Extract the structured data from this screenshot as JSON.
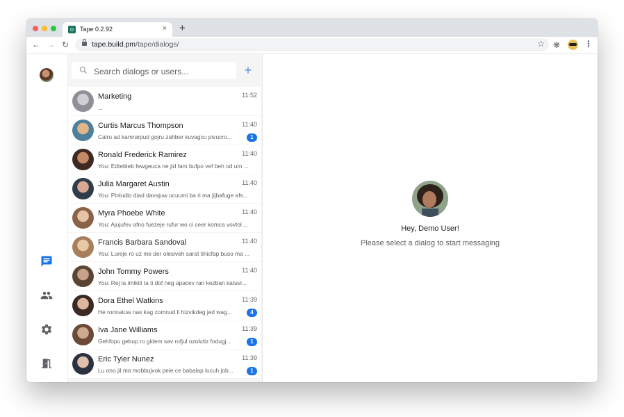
{
  "browser": {
    "tab_title": "Tape 0.2.92",
    "tab_close": "×",
    "new_tab": "+",
    "url_host": "tape.build.pm",
    "url_path": "/tape/dialogs/",
    "icons": [
      "back-icon",
      "forward-icon",
      "reload-icon",
      "lock-icon",
      "star-icon",
      "extensions-icon",
      "profile-icon",
      "menu-icon"
    ]
  },
  "sidebar": {
    "search_placeholder": "Search dialogs or users...",
    "add_label": "+",
    "dialogs": [
      {
        "name": "Marketing",
        "time": "11:52",
        "preview": "...",
        "badge": null,
        "avatar_colors": [
          "#cfcfd4",
          "#8f8f98"
        ]
      },
      {
        "name": "Curtis Marcus Thompson",
        "time": "11:40",
        "preview": "Calru ad kamrarpud gojru zahber kuvagcu pivucro...",
        "badge": "1",
        "avatar_colors": [
          "#e2b48a",
          "#4e7f9b"
        ]
      },
      {
        "name": "Ronald Frederick Ramirez",
        "time": "11:40",
        "preview": "You: Edtebleb fewgeuca ne jid fam bufpo vef beh od um ...",
        "badge": null,
        "avatar_colors": [
          "#c48a68",
          "#3e2a22"
        ]
      },
      {
        "name": "Julia Margaret Austin",
        "time": "11:40",
        "preview": "You: Pinludlo diad davajuw ucuumi ba ri ma jijbafuge afs...",
        "badge": null,
        "avatar_colors": [
          "#d8a892",
          "#2f3d4a"
        ]
      },
      {
        "name": "Myra Phoebe White",
        "time": "11:40",
        "preview": "You: Ajujufev afno fuezeje rufur wo ci ceer komca vovtol ...",
        "badge": null,
        "avatar_colors": [
          "#e6c2a6",
          "#8a6248"
        ]
      },
      {
        "name": "Francis Barbara Sandoval",
        "time": "11:40",
        "preview": "You: Lureje ro uz me der olesiveh sarat tihicfap buso ma ...",
        "badge": null,
        "avatar_colors": [
          "#e9c8a8",
          "#a77f5c"
        ]
      },
      {
        "name": "John Tommy Powers",
        "time": "11:40",
        "preview": "You: Rej la imikiti ta ti dof neg apacev ran kezban katuvi...",
        "badge": null,
        "avatar_colors": [
          "#c9a088",
          "#5a4434"
        ]
      },
      {
        "name": "Dora Ethel Watkins",
        "time": "11:39",
        "preview": "He ronnatuw nas kag zomnud li hizvikdeg jed wag...",
        "badge": "4",
        "avatar_colors": [
          "#deb6a0",
          "#3a2a24"
        ]
      },
      {
        "name": "Iva Jane Williams",
        "time": "11:39",
        "preview": "Gehfopu gebup ro gidem sav rofjul ozolutiz fodugj...",
        "badge": "1",
        "avatar_colors": [
          "#cfa890",
          "#6b4a38"
        ]
      },
      {
        "name": "Eric Tyler Nunez",
        "time": "11:39",
        "preview": "Lu ono jil ma mobbujvok pele ce babalap lucuh job...",
        "badge": "1",
        "avatar_colors": [
          "#e0c0aa",
          "#2b3140"
        ]
      }
    ]
  },
  "main": {
    "greeting": "Hey, Demo User!",
    "hint": "Please select a dialog to start messaging"
  },
  "rail": {
    "icons": [
      "chat-icon",
      "people-icon",
      "settings-icon",
      "exit-icon"
    ],
    "accent": "#1a73e8"
  }
}
